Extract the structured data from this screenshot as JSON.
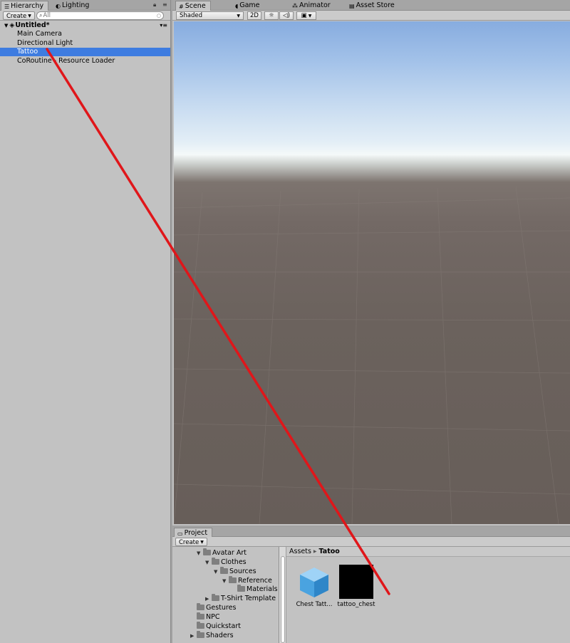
{
  "hierarchy": {
    "tabs": [
      {
        "label": "Hierarchy",
        "icon": "list-icon",
        "active": true
      },
      {
        "label": "Lighting",
        "icon": "lightbulb-icon",
        "active": false
      }
    ],
    "create_label": "Create",
    "search_placeholder": "All",
    "scene_name": "Untitled*",
    "items": [
      {
        "label": "Main Camera"
      },
      {
        "label": "Directional Light"
      },
      {
        "label": "Tattoo",
        "selected": true
      },
      {
        "label": "CoRoutine - Resource Loader"
      }
    ]
  },
  "scene_view": {
    "tabs": [
      {
        "label": "Scene",
        "icon": "scene-grid-icon",
        "active": true
      },
      {
        "label": "Game",
        "icon": "gamepad-icon",
        "active": false
      },
      {
        "label": "Animator",
        "icon": "animator-icon",
        "active": false
      },
      {
        "label": "Asset Store",
        "icon": "store-icon",
        "active": false
      }
    ],
    "draw_mode": "Shaded",
    "mode_2d_label": "2D",
    "sky_color": "#a3c2e9",
    "ground_color": "#6b625d"
  },
  "project": {
    "tab_label": "Project",
    "create_label": "Create",
    "folders": [
      {
        "label": "Avatar Art",
        "expanded": true
      },
      {
        "label": "Clothes",
        "expanded": true
      },
      {
        "label": "Sources",
        "expanded": true
      },
      {
        "label": "Reference",
        "expanded": true
      },
      {
        "label": "Materials",
        "expanded": false
      },
      {
        "label": "T-Shirt Template",
        "expanded": false
      },
      {
        "label": "Gestures",
        "expanded": false
      },
      {
        "label": "NPC",
        "expanded": false
      },
      {
        "label": "Quickstart",
        "expanded": false
      },
      {
        "label": "Shaders",
        "expanded": false
      }
    ],
    "breadcrumb": [
      "Assets",
      "Tatoo"
    ],
    "assets": [
      {
        "label": "Chest Tatt...",
        "icon": "cube-icon"
      },
      {
        "label": "tattoo_chest",
        "icon": "black-texture-thumbnail"
      }
    ]
  },
  "annotation": {
    "color": "#e0161a"
  }
}
